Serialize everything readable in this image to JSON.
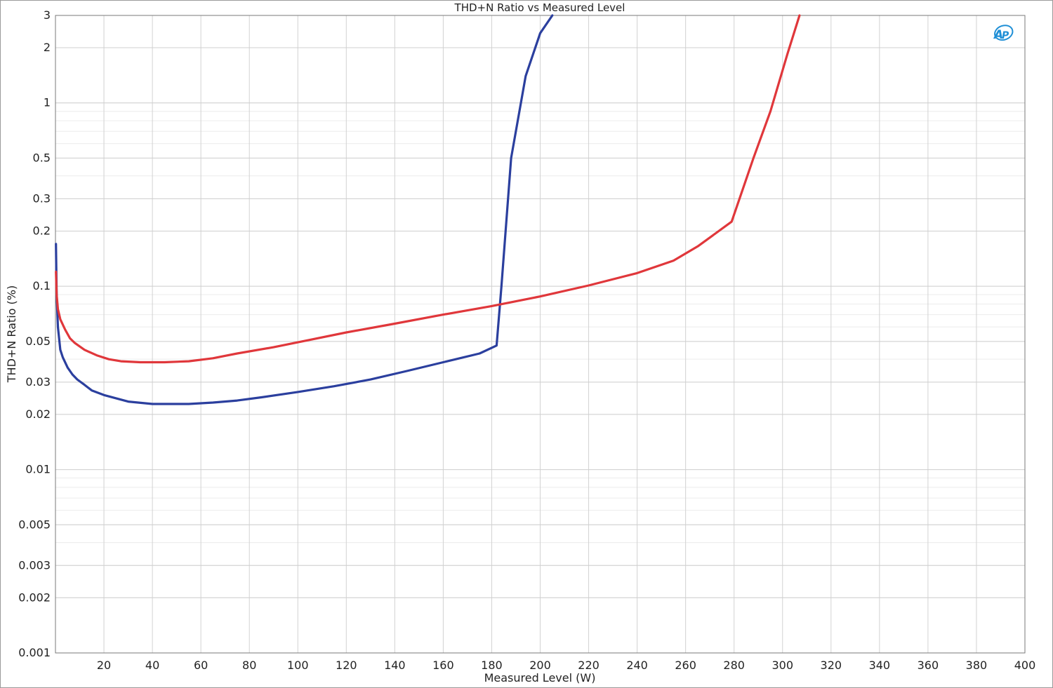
{
  "chart_data": {
    "type": "line",
    "title": "THD+N Ratio vs Measured Level",
    "xlabel": "Measured Level (W)",
    "ylabel": "THD+N Ratio (%)",
    "xlim": [
      0,
      400
    ],
    "ylim": [
      0.001,
      3
    ],
    "yscale": "log",
    "grid": true,
    "x_ticks": [
      "20",
      "40",
      "60",
      "80",
      "100",
      "120",
      "140",
      "160",
      "180",
      "200",
      "220",
      "240",
      "260",
      "280",
      "300",
      "320",
      "340",
      "360",
      "380",
      "400"
    ],
    "y_ticks": [
      "3",
      "2",
      "1",
      "0.5",
      "0.3",
      "0.2",
      "0.1",
      "0.05",
      "0.03",
      "0.02",
      "0.01",
      "0.005",
      "0.003",
      "0.002",
      "0.001"
    ],
    "logo_text": "AP",
    "series": [
      {
        "color": "#2b3f9e",
        "points": [
          [
            0.2,
            0.17
          ],
          [
            0.5,
            0.09
          ],
          [
            1,
            0.06
          ],
          [
            2,
            0.045
          ],
          [
            3,
            0.041
          ],
          [
            5,
            0.036
          ],
          [
            7,
            0.033
          ],
          [
            9,
            0.031
          ],
          [
            12,
            0.029
          ],
          [
            15,
            0.027
          ],
          [
            20,
            0.0255
          ],
          [
            30,
            0.0235
          ],
          [
            40,
            0.0228
          ],
          [
            55,
            0.0228
          ],
          [
            65,
            0.0232
          ],
          [
            75,
            0.0238
          ],
          [
            85,
            0.0248
          ],
          [
            100,
            0.0265
          ],
          [
            115,
            0.0285
          ],
          [
            130,
            0.031
          ],
          [
            145,
            0.0345
          ],
          [
            160,
            0.0385
          ],
          [
            175,
            0.043
          ],
          [
            182,
            0.0475
          ],
          [
            184,
            0.1
          ],
          [
            188,
            0.5
          ],
          [
            194,
            1.4
          ],
          [
            200,
            2.4
          ],
          [
            205,
            3.0
          ]
        ]
      },
      {
        "color": "#e0373b",
        "points": [
          [
            0.2,
            0.12
          ],
          [
            0.5,
            0.09
          ],
          [
            1,
            0.075
          ],
          [
            2,
            0.066
          ],
          [
            4,
            0.058
          ],
          [
            6,
            0.052
          ],
          [
            8,
            0.049
          ],
          [
            12,
            0.045
          ],
          [
            17,
            0.042
          ],
          [
            22,
            0.04
          ],
          [
            27,
            0.039
          ],
          [
            35,
            0.0385
          ],
          [
            45,
            0.0385
          ],
          [
            55,
            0.039
          ],
          [
            65,
            0.0405
          ],
          [
            75,
            0.043
          ],
          [
            90,
            0.0465
          ],
          [
            105,
            0.051
          ],
          [
            120,
            0.056
          ],
          [
            140,
            0.0625
          ],
          [
            160,
            0.07
          ],
          [
            180,
            0.078
          ],
          [
            200,
            0.088
          ],
          [
            220,
            0.101
          ],
          [
            240,
            0.118
          ],
          [
            255,
            0.138
          ],
          [
            265,
            0.165
          ],
          [
            279,
            0.225
          ],
          [
            288,
            0.5
          ],
          [
            295,
            0.9
          ],
          [
            302,
            1.85
          ],
          [
            307,
            3.0
          ]
        ]
      }
    ]
  }
}
